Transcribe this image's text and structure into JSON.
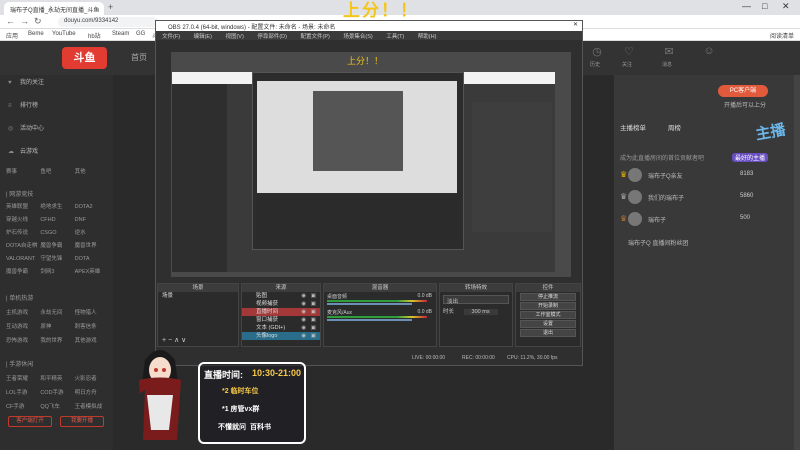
{
  "browser": {
    "tab_title": "瑞布子Q直播_永劫无间直播_斗鱼",
    "new_tab": "+",
    "url": "douyu.com/9334142",
    "bookmarks": [
      "应用",
      "Beme",
      "YouTube",
      "hb站",
      "Steam",
      "GG",
      "斗鱼"
    ],
    "reader_list": "阅读清单",
    "controls": {
      "min": "—",
      "max": "□",
      "close": "✕"
    }
  },
  "top_overlay": "上分！！",
  "site": {
    "logo": "斗鱼",
    "home": "首页",
    "header_icons": [
      "历史",
      "关注",
      "消息",
      "下载"
    ],
    "pc_client": "PC客户端",
    "open_text": "开播后可以上分"
  },
  "sidebar": {
    "items": [
      {
        "icon": "♥",
        "label": "我的关注"
      },
      {
        "icon": "≡",
        "label": "排行榜"
      },
      {
        "icon": "◎",
        "label": "活动中心"
      },
      {
        "icon": "☁",
        "label": "云游戏"
      }
    ],
    "quick": [
      "赛事",
      "鱼吧",
      "其他"
    ],
    "section_games": "| 网游竞技",
    "games_grid": [
      [
        "英雄联盟",
        "绝地求生",
        "DOTA2"
      ],
      [
        "穿越火线",
        "CFHD",
        "DNF"
      ],
      [
        "炉石传说",
        "CSGO",
        "逆水"
      ],
      [
        "DOTA自走棋",
        "魔兽争霸",
        "魔兽世界"
      ],
      [
        "VALORANT",
        "守望先锋",
        "DOTA"
      ],
      [
        "魔兽争霸",
        "剑网3",
        "APEX英雄"
      ]
    ],
    "section_single": "| 单机热游",
    "single_grid": [
      [
        "主机游戏",
        "永劫无间",
        "怪物猎人"
      ],
      [
        "互动游戏",
        "原神",
        "刺客信条"
      ],
      [
        "恐怖游戏",
        "我的世界",
        "其他游戏"
      ]
    ],
    "section_mobile": "| 手游休闲",
    "mobile_grid": [
      [
        "王者荣耀",
        "和平精英",
        "火影忍者"
      ],
      [
        "LOL手游",
        "COD手游",
        "明日方舟"
      ],
      [
        "CF手游",
        "QQ飞车",
        "王者模拟战"
      ]
    ],
    "btn_apply": "客户端打开",
    "btn_open": "我要开播"
  },
  "right_panel": {
    "tabs": [
      "主播榜单",
      "周榜"
    ],
    "badge": "最好的主播",
    "desc": "成为此直播房间的首位贡献者吧",
    "ranks": [
      {
        "name": "瑞布子Q亲友",
        "score": "8183"
      },
      {
        "name": "我们的瑞布子",
        "score": "5860"
      },
      {
        "name": "瑞布子",
        "score": "500"
      }
    ],
    "fans_text": "瑞布子Q 直播间粉丝团"
  },
  "obs": {
    "title": "OBS 27.0.4 (64-bit, windows) - 配置文件: 未命名 - 场景: 未命名",
    "menu": [
      "文件(F)",
      "编辑(E)",
      "视图(V)",
      "停靠部件(D)",
      "配置文件(P)",
      "场景集合(S)",
      "工具(T)",
      "帮助(H)"
    ],
    "docks": {
      "scenes": "场景",
      "sources": "来源",
      "mixer": "混音器",
      "transitions": "转场特效",
      "controls": "控件"
    },
    "scene_item": "场景",
    "sources_list": [
      {
        "name": "贴图",
        "sel": ""
      },
      {
        "name": "视频捕获",
        "sel": ""
      },
      {
        "name": "直播时间",
        "sel": "sel"
      },
      {
        "name": "窗口捕获",
        "sel": ""
      },
      {
        "name": "文本 (GDI+)",
        "sel": ""
      },
      {
        "name": "头像logo",
        "sel": "sel2"
      }
    ],
    "mixer_rows": [
      {
        "name": "桌面音频",
        "db": "0.0 dB"
      },
      {
        "name": "麦克风/Aux",
        "db": "0.0 dB"
      }
    ],
    "transition_value": "淡出",
    "duration_label": "时长",
    "duration_value": "300 ms",
    "control_buttons": [
      "停止推流",
      "开始录制",
      "工作室模式",
      "设置",
      "退出"
    ],
    "status": {
      "live": "LIVE: 00:00:00",
      "rec": "REC: 00:00:00",
      "cpu": "CPU: 11.2%, 30.00 fps"
    }
  },
  "stream_overlay": {
    "time_label": "直播时间:",
    "time_value": "10:30-21:00",
    "line1": "*2 临时车位",
    "line2": "*1 房管vx群",
    "bottom1": "不懂就问",
    "bottom2": "百科书"
  },
  "colors": {
    "brand_red": "#e23b32",
    "overlay_yellow": "#f7c948",
    "obs_selected": "#a23838"
  }
}
